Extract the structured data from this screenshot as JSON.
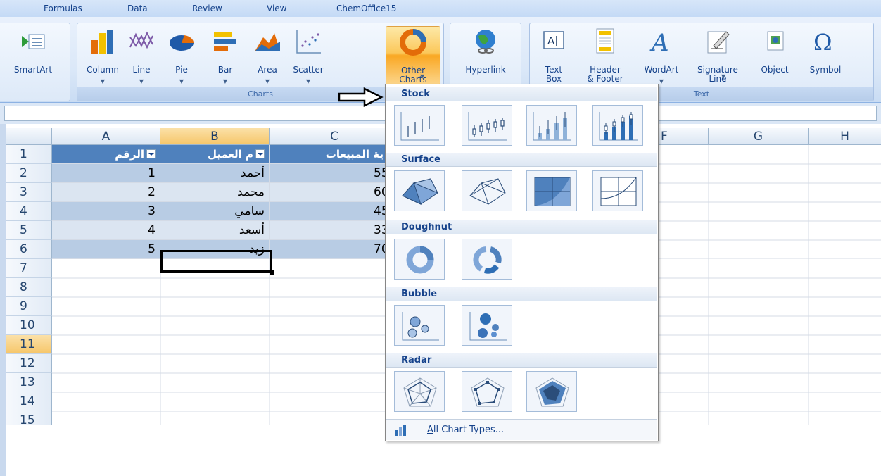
{
  "tabs": [
    "Formulas",
    "Data",
    "Review",
    "View",
    "ChemOffice15"
  ],
  "ribbon": {
    "smartart": "SmartArt",
    "charts_group": "Charts",
    "text_group": "Text",
    "column": "Column",
    "line": "Line",
    "pie": "Pie",
    "bar": "Bar",
    "area": "Area",
    "scatter": "Scatter",
    "other_charts": "Other\nCharts",
    "hyperlink": "Hyperlink",
    "textbox": "Text\nBox",
    "header_footer": "Header\n& Footer",
    "wordart": "WordArt",
    "signature_line": "Signature\nLine",
    "object": "Object",
    "symbol": "Symbol"
  },
  "sheet": {
    "columns": [
      "A",
      "B",
      "C",
      "F",
      "G",
      "H"
    ],
    "rows": [
      "1",
      "2",
      "3",
      "4",
      "5",
      "6",
      "7",
      "8",
      "9",
      "10",
      "11",
      "12",
      "13",
      "14",
      "15"
    ],
    "headers": [
      "الرقم",
      "م العميل",
      "ية المبيعات"
    ],
    "data": [
      [
        "1",
        "أحمد",
        "55"
      ],
      [
        "2",
        "محمد",
        "60"
      ],
      [
        "3",
        "سامي",
        "45"
      ],
      [
        "4",
        "أسعد",
        "33"
      ],
      [
        "5",
        "زيد",
        "70"
      ]
    ]
  },
  "gallery": {
    "sections": [
      "Stock",
      "Surface",
      "Doughnut",
      "Bubble",
      "Radar"
    ],
    "footer_link_prefix": "A",
    "footer_link_rest": "ll Chart Types..."
  },
  "colors": {
    "table_header": "#4f81bd",
    "band_row": "#b8cce4",
    "active_button": "#fbc85b",
    "ribbon_text": "#15428b"
  }
}
